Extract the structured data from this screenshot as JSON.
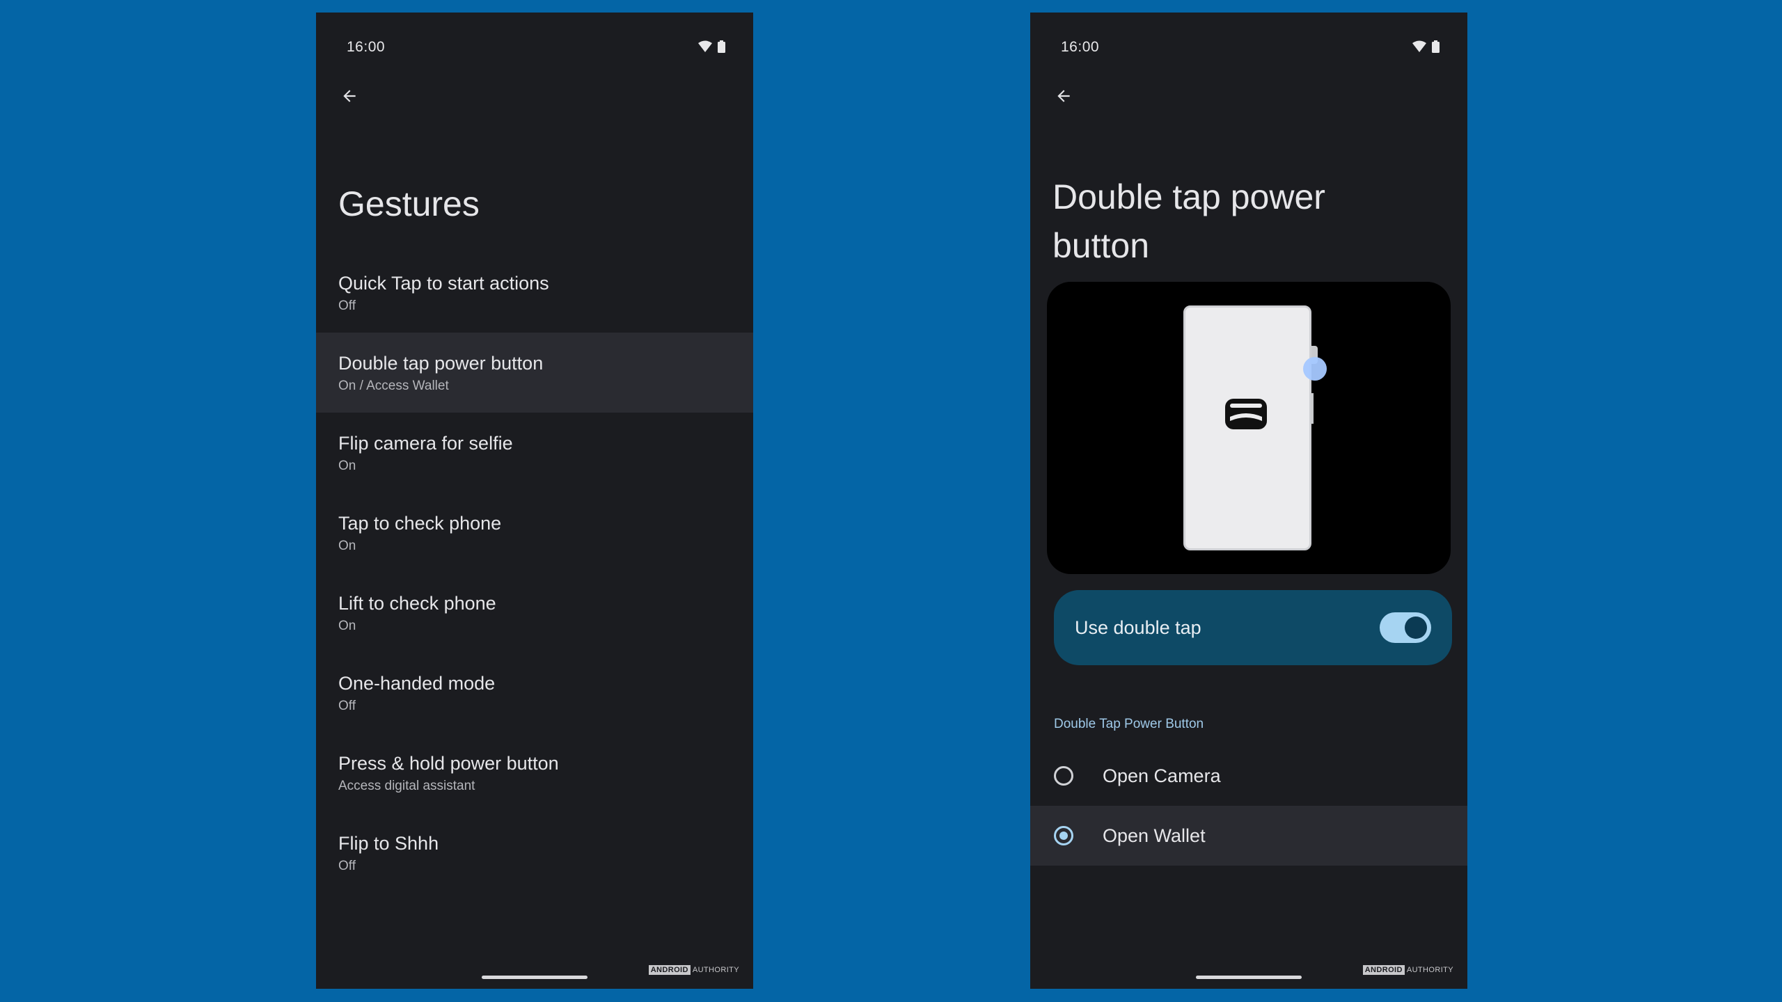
{
  "left_screen": {
    "status": {
      "time": "16:00"
    },
    "title": "Gestures",
    "items": [
      {
        "title": "Quick Tap to start actions",
        "summary": "Off"
      },
      {
        "title": "Double tap power button",
        "summary": "On / Access Wallet"
      },
      {
        "title": "Flip camera for selfie",
        "summary": "On"
      },
      {
        "title": "Tap to check phone",
        "summary": "On"
      },
      {
        "title": "Lift to check phone",
        "summary": "On"
      },
      {
        "title": "One-handed mode",
        "summary": "Off"
      },
      {
        "title": "Press & hold power button",
        "summary": "Access digital assistant"
      },
      {
        "title": "Flip to Shhh",
        "summary": "Off"
      }
    ],
    "watermark": {
      "brand": "ANDROID",
      "suffix": "AUTHORITY"
    }
  },
  "right_screen": {
    "status": {
      "time": "16:00"
    },
    "title": "Double tap power button",
    "toggle": {
      "label": "Use double tap",
      "on": true
    },
    "section_header": "Double Tap Power Button",
    "options": [
      {
        "label": "Open Camera",
        "selected": false
      },
      {
        "label": "Open Wallet",
        "selected": true
      }
    ],
    "watermark": {
      "brand": "ANDROID",
      "suffix": "AUTHORITY"
    }
  },
  "colors": {
    "background": "#0465a6",
    "screen": "#1b1c20",
    "active_row": "#2a2b31",
    "accent": "#a6d4f2",
    "toggle_card": "#0e4a66"
  },
  "icons": {
    "back": "arrow-back-icon",
    "wifi": "wifi-icon",
    "battery": "battery-icon",
    "wallet": "wallet-icon"
  }
}
